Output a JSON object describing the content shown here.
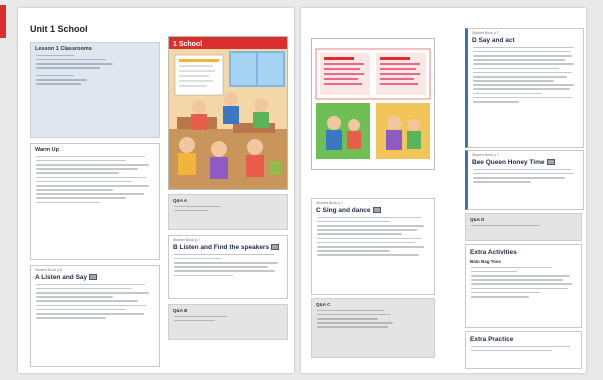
{
  "page1": {
    "unit_title": "Unit 1 School",
    "lesson_box": {
      "heading": "Lesson 1 Classrooms",
      "sub1": "Objectives",
      "sub2": "Materials"
    },
    "warm_up": {
      "heading": "Warm Up"
    },
    "box_a": {
      "tag": "Student Book p.6",
      "title": "A Listen and Say",
      "cd": "CD1"
    },
    "book": {
      "label": "1 School"
    },
    "grey1": {
      "label": "Q&A A"
    },
    "box_b": {
      "tag": "Student Book p.7",
      "title": "B Listen and Find the speakers",
      "cd": "CD1"
    },
    "grey2": {
      "label": "Q&A B"
    }
  },
  "page2": {
    "box_d": {
      "tag": "Student Book p.7",
      "title": "D Say and act"
    },
    "box_c": {
      "tag": "Student Book p.7",
      "title": "C Sing and dance",
      "cd": "CD1"
    },
    "grey3": {
      "label": "Q&A C"
    },
    "box_queen": {
      "tag": "Student Book p.7",
      "title": "Bee Queen Honey Time",
      "cd": "CD1"
    },
    "grey4": {
      "label": "Q&A D"
    },
    "extra_activities": {
      "heading": "Extra Activities",
      "sub": "Bam Bag Toss"
    },
    "extra_practice": {
      "heading": "Extra Practice"
    }
  },
  "colors": {
    "accent_red": "#d9302f",
    "blue_bar": "#3c6fb4",
    "blue_box": "#dfe6f0"
  }
}
